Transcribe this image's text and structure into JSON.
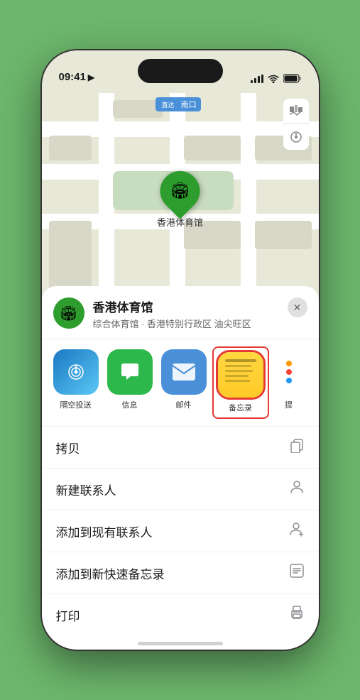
{
  "status_bar": {
    "time": "09:41",
    "location_icon": "▶"
  },
  "map": {
    "label": "南口",
    "location_name": "香港体育馆",
    "location_desc": "综合体育馆 · 香港特别行政区 油尖旺区"
  },
  "share_items": [
    {
      "id": "airdrop",
      "label": "隔空投送",
      "emoji": "📡"
    },
    {
      "id": "messages",
      "label": "信息",
      "emoji": "💬"
    },
    {
      "id": "mail",
      "label": "邮件",
      "emoji": "✉️"
    },
    {
      "id": "notes",
      "label": "备忘录",
      "emoji": ""
    },
    {
      "id": "more",
      "label": "提",
      "emoji": ""
    }
  ],
  "actions": [
    {
      "id": "copy",
      "label": "拷贝",
      "icon": "copy"
    },
    {
      "id": "new-contact",
      "label": "新建联系人",
      "icon": "person"
    },
    {
      "id": "add-existing",
      "label": "添加到现有联系人",
      "icon": "person-add"
    },
    {
      "id": "add-notes",
      "label": "添加到新快速备忘录",
      "icon": "notes"
    },
    {
      "id": "print",
      "label": "打印",
      "icon": "print"
    }
  ]
}
